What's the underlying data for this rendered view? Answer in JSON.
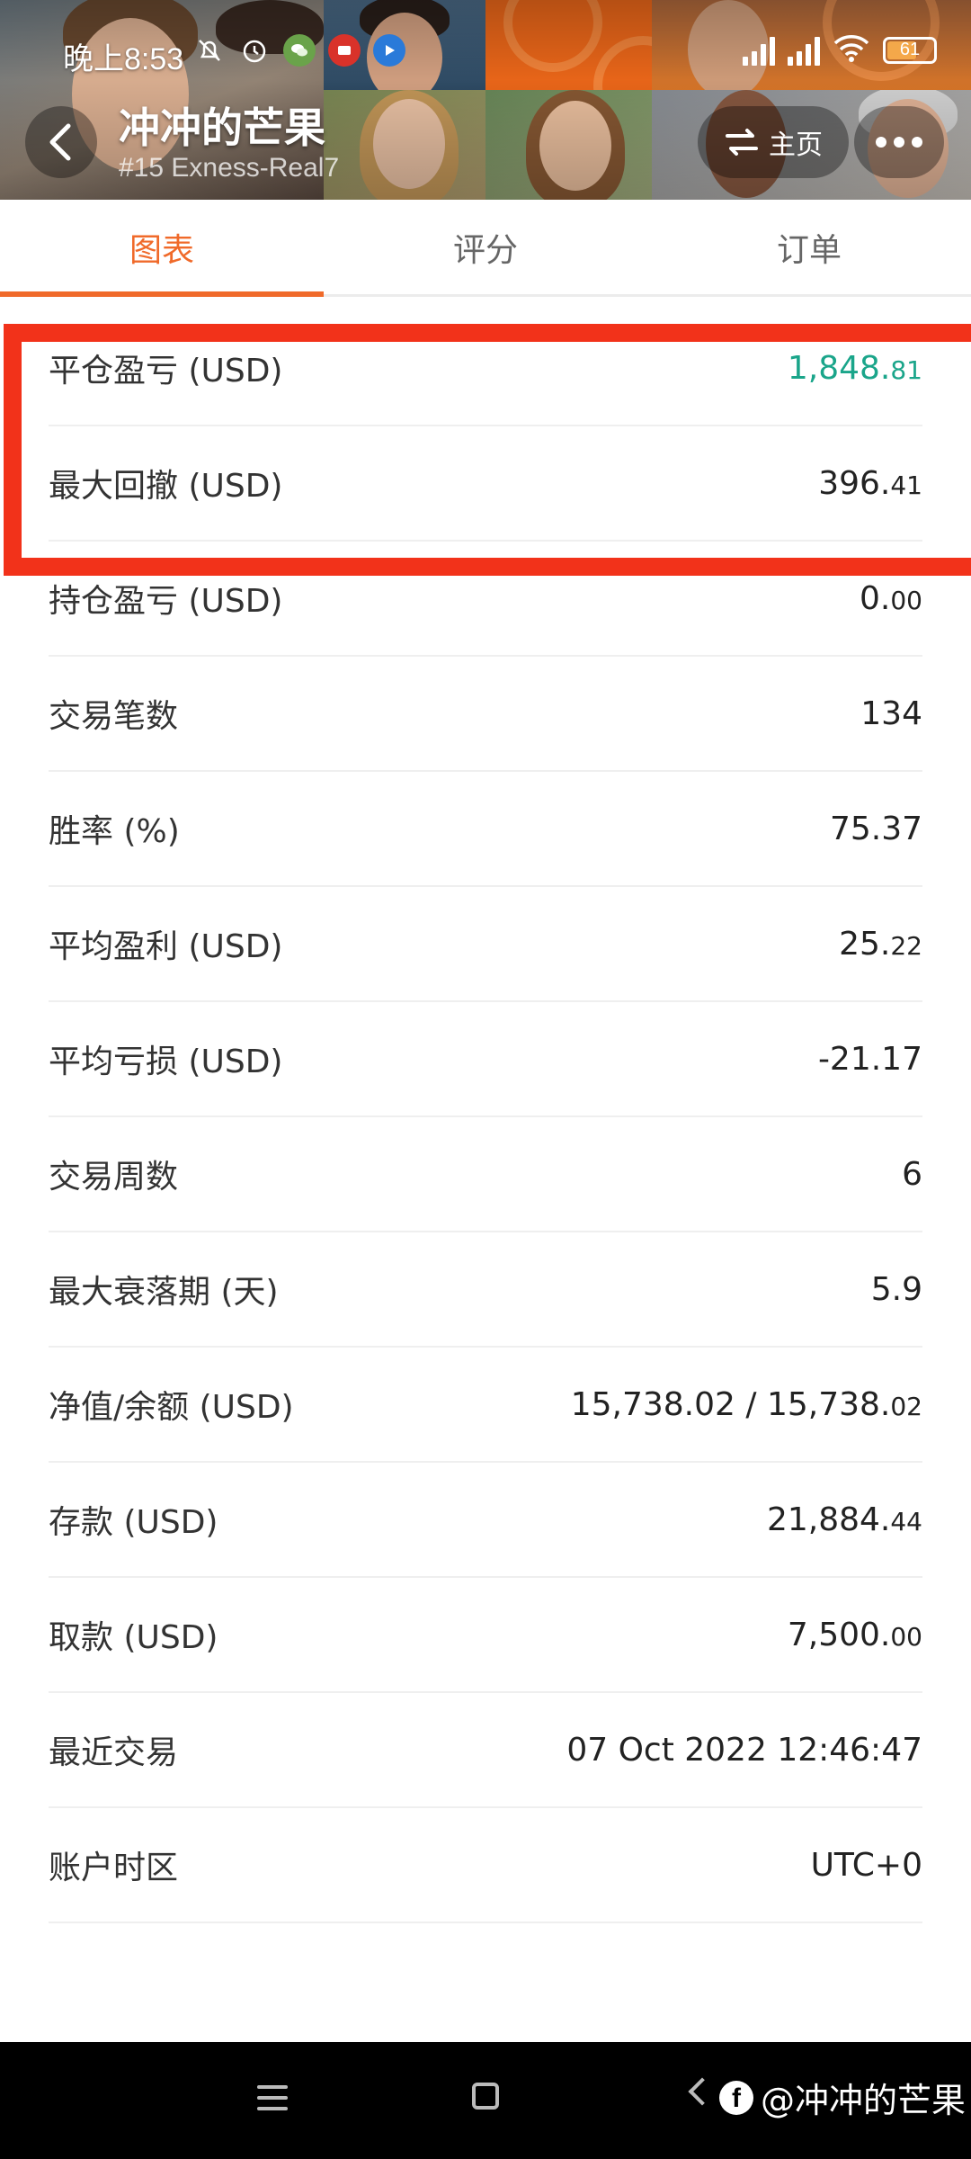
{
  "status_bar": {
    "time": "晚上8:53",
    "battery": "61"
  },
  "header": {
    "title": "冲冲的芒果",
    "subtitle": "#15  Exness-Real7",
    "home_label": "主页"
  },
  "tabs": [
    {
      "label": "图表",
      "active": true
    },
    {
      "label": "评分",
      "active": false
    },
    {
      "label": "订单",
      "active": false
    }
  ],
  "stats": [
    {
      "label": "平仓盈亏 (USD)",
      "value_main": "1,848.",
      "value_dec": "81",
      "positive": true
    },
    {
      "label": "最大回撤 (USD)",
      "value_main": "396.",
      "value_dec": "41"
    },
    {
      "label": "持仓盈亏 (USD)",
      "value_main": "0.",
      "value_dec": "00"
    },
    {
      "label": "交易笔数",
      "value_main": "134",
      "value_dec": ""
    },
    {
      "label": "胜率 (%)",
      "value_main": "75.37",
      "value_dec": ""
    },
    {
      "label": "平均盈利 (USD)",
      "value_main": "25.",
      "value_dec": "22"
    },
    {
      "label": "平均亏损 (USD)",
      "value_main": "-21.17",
      "value_dec": ""
    },
    {
      "label": "交易周数",
      "value_main": "6",
      "value_dec": ""
    },
    {
      "label": "最大衰落期 (天)",
      "value_main": "5.9",
      "value_dec": ""
    },
    {
      "label": "净值/余额 (USD)",
      "value_main": "15,738.02 / 15,738.",
      "value_dec": "02"
    },
    {
      "label": "存款 (USD)",
      "value_main": "21,884.",
      "value_dec": "44"
    },
    {
      "label": "取款 (USD)",
      "value_main": "7,500.",
      "value_dec": "00"
    },
    {
      "label": "最近交易",
      "value_main": "07 Oct 2022 12:46:47",
      "value_dec": ""
    },
    {
      "label": "账户时区",
      "value_main": "UTC+0",
      "value_dec": ""
    }
  ],
  "watermark": "@冲冲的芒果",
  "colors": {
    "accent": "#f06a2a",
    "positive": "#1aa58a",
    "highlight": "#f2321a"
  }
}
